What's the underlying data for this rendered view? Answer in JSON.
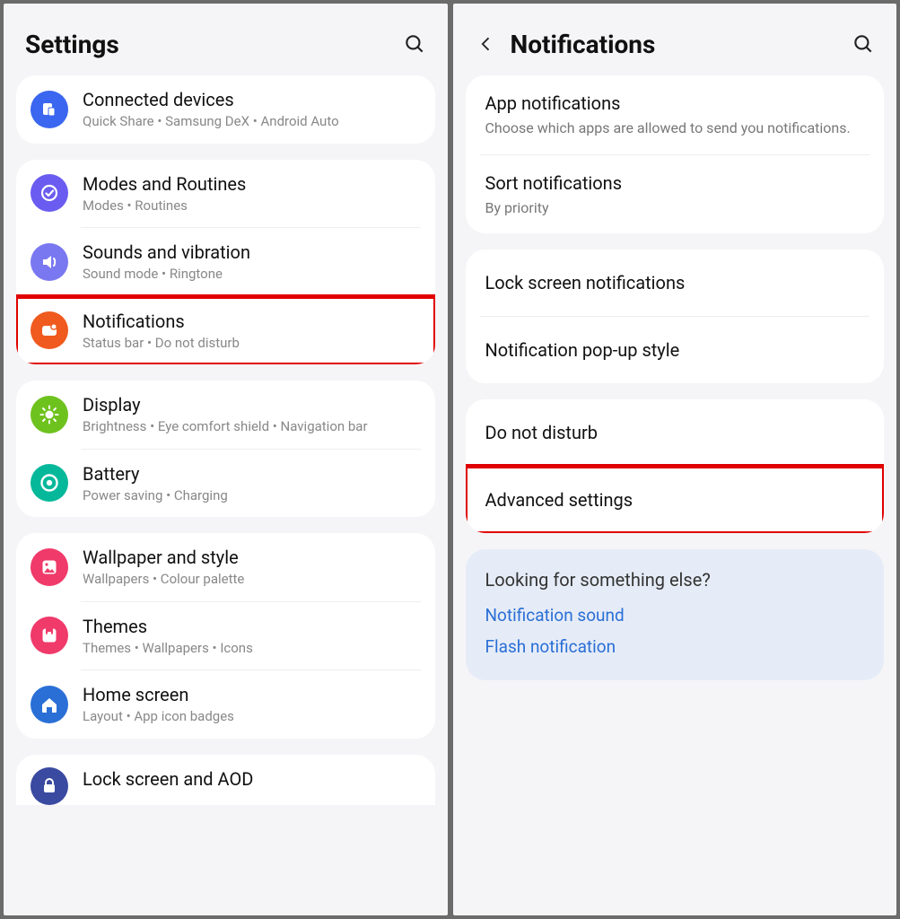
{
  "left": {
    "title": "Settings",
    "groups": [
      {
        "items": [
          {
            "icon": "connected-devices-icon",
            "bg": "bg-blue",
            "title": "Connected devices",
            "subtitle": "Quick Share  •  Samsung DeX  •  Android Auto"
          }
        ]
      },
      {
        "items": [
          {
            "icon": "modes-routines-icon",
            "bg": "bg-purple",
            "title": "Modes and Routines",
            "subtitle": "Modes  •  Routines"
          },
          {
            "icon": "sounds-icon",
            "bg": "bg-lav",
            "title": "Sounds and vibration",
            "subtitle": "Sound mode  •  Ringtone"
          },
          {
            "icon": "notifications-icon",
            "bg": "bg-orange",
            "title": "Notifications",
            "subtitle": "Status bar  •  Do not disturb",
            "highlight": true
          }
        ]
      },
      {
        "items": [
          {
            "icon": "display-icon",
            "bg": "bg-green",
            "title": "Display",
            "subtitle": "Brightness  •  Eye comfort shield  •  Navigation bar"
          },
          {
            "icon": "battery-icon",
            "bg": "bg-teal",
            "title": "Battery",
            "subtitle": "Power saving  •  Charging"
          }
        ]
      },
      {
        "items": [
          {
            "icon": "wallpaper-icon",
            "bg": "bg-pink",
            "title": "Wallpaper and style",
            "subtitle": "Wallpapers  •  Colour palette"
          },
          {
            "icon": "themes-icon",
            "bg": "bg-pink2",
            "title": "Themes",
            "subtitle": "Themes  •  Wallpapers  •  Icons"
          },
          {
            "icon": "home-icon",
            "bg": "bg-bluehome",
            "title": "Home screen",
            "subtitle": "Layout  •  App icon badges"
          }
        ]
      },
      {
        "cutoff": true,
        "items": [
          {
            "icon": "lockscreen-icon",
            "bg": "bg-navy",
            "title": "Lock screen and AOD",
            "subtitle": ""
          }
        ]
      }
    ]
  },
  "right": {
    "title": "Notifications",
    "groups": [
      {
        "items": [
          {
            "title": "App notifications",
            "subtitle": "Choose which apps are allowed to send you notifications."
          },
          {
            "title": "Sort notifications",
            "subtitle": "By priority",
            "sublink": true
          }
        ]
      },
      {
        "items": [
          {
            "title": "Lock screen notifications"
          },
          {
            "title": "Notification pop-up style"
          }
        ]
      },
      {
        "items": [
          {
            "title": "Do not disturb"
          },
          {
            "title": "Advanced settings",
            "highlight": true
          }
        ]
      }
    ],
    "lookingFor": {
      "heading": "Looking for something else?",
      "links": [
        "Notification sound",
        "Flash notification"
      ]
    }
  }
}
